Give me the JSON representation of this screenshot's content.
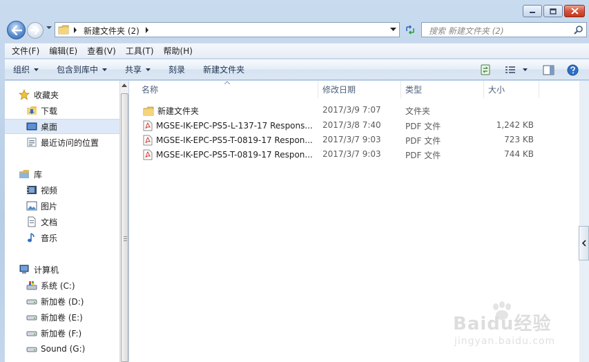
{
  "address": {
    "path": "新建文件夹 (2)",
    "search_placeholder": "搜索 新建文件夹 (2)"
  },
  "menu": [
    "文件(F)",
    "编辑(E)",
    "查看(V)",
    "工具(T)",
    "帮助(H)"
  ],
  "commands": {
    "organize": "组织",
    "include_library": "包含到库中",
    "share": "共享",
    "burn": "刻录",
    "new_folder": "新建文件夹"
  },
  "nav": {
    "favorites": "收藏夹",
    "downloads": "下载",
    "desktop": "桌面",
    "recent": "最近访问的位置",
    "libraries": "库",
    "videos": "视频",
    "pictures": "图片",
    "documents": "文档",
    "music": "音乐",
    "computer": "计算机",
    "drive_c": "系统 (C:)",
    "drive_d": "新加卷 (D:)",
    "drive_e": "新加卷 (E:)",
    "drive_f": "新加卷 (F:)",
    "drive_g": "Sound (G:)"
  },
  "columns": {
    "name": "名称",
    "modified": "修改日期",
    "type": "类型",
    "size": "大小"
  },
  "files": [
    {
      "name": "新建文件夹",
      "modified": "2017/3/9 7:07",
      "type": "文件夹",
      "size": "",
      "icon": "folder-icon"
    },
    {
      "name": "MGSE-IK-EPC-PS5-L-137-17 Respons...",
      "modified": "2017/3/8 7:40",
      "type": "PDF 文件",
      "size": "1,242 KB",
      "icon": "pdf-icon"
    },
    {
      "name": "MGSE-IK-EPC-PS5-T-0819-17 Respon...",
      "modified": "2017/3/7 9:03",
      "type": "PDF 文件",
      "size": "723 KB",
      "icon": "pdf-icon"
    },
    {
      "name": "MGSE-IK-EPC-PS5-T-0819-17 Respon...",
      "modified": "2017/3/7 9:03",
      "type": "PDF 文件",
      "size": "744 KB",
      "icon": "pdf-icon"
    }
  ],
  "watermark": {
    "main": "Baidu经验",
    "sub": "jingyan.baidu.com"
  },
  "colors": {
    "accent": "#3a6fb8",
    "selected_bg": "#dde9f8",
    "header_text": "#4c607a"
  }
}
